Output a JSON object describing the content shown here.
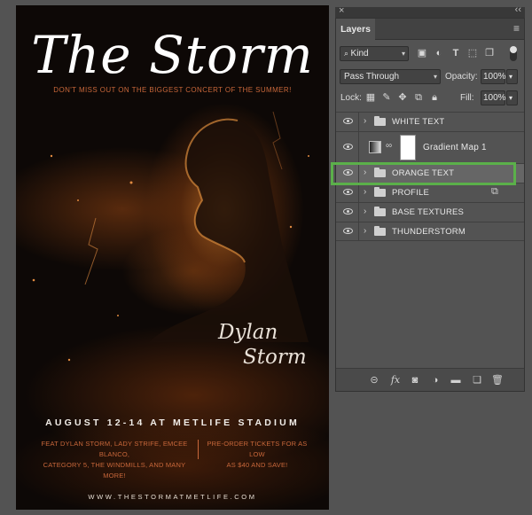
{
  "poster": {
    "title": "The Storm",
    "tagline": "DON'T MISS OUT ON THE BIGGEST CONCERT OF THE SUMMER!",
    "artist_first": "Dylan",
    "artist_last": "Storm",
    "dates": "AUGUST 12-14 AT METLIFE STADIUM",
    "feat_left_line1": "FEAT DYLAN STORM, LADY STRIFE, EMCEE BLANCO,",
    "feat_left_line2": "CATEGORY 5, THE WINDMILLS, AND MANY MORE!",
    "feat_right_line1": "PRE-ORDER TICKETS FOR AS LOW",
    "feat_right_line2": "AS $40 AND SAVE!",
    "url": "WWW.THESTORMATMETLIFE.COM"
  },
  "panel": {
    "close_glyph": "×",
    "collapse_glyph": "‹‹",
    "tab_label": "Layers",
    "filter_value": "Kind",
    "blend_mode": "Pass Through",
    "opacity_label": "Opacity:",
    "opacity_value": "100%",
    "lock_label": "Lock:",
    "fill_label": "Fill:",
    "fill_value": "100%"
  },
  "layers": [
    {
      "name": "WHITE TEXT",
      "type": "group"
    },
    {
      "name": "Gradient Map 1",
      "type": "adjustment"
    },
    {
      "name": "ORANGE TEXT",
      "type": "group",
      "selected": true
    },
    {
      "name": "PROFILE",
      "type": "group"
    },
    {
      "name": "BASE TEXTURES",
      "type": "group"
    },
    {
      "name": "THUNDERSTORM",
      "type": "group"
    }
  ],
  "colors": {
    "highlight": "#5bb04a",
    "accent_orange": "#c8673a"
  }
}
